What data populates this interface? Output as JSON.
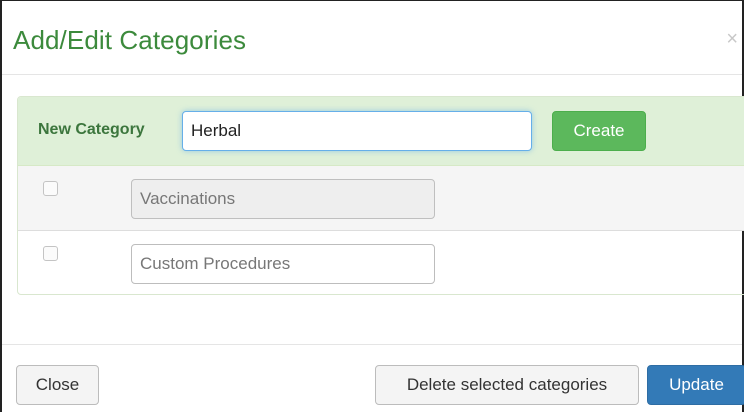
{
  "modal": {
    "title": "Add/Edit Categories",
    "close_glyph": "×"
  },
  "new_category": {
    "label": "New Category",
    "value": "Herbal",
    "create_label": "Create"
  },
  "categories": [
    {
      "name": "Vaccinations",
      "readonly": true,
      "checked": false
    },
    {
      "name": "Custom Procedures",
      "readonly": false,
      "checked": false
    }
  ],
  "footer": {
    "close_label": "Close",
    "delete_label": "Delete selected categories",
    "update_label": "Update"
  },
  "colors": {
    "title": "#3c8a3c",
    "panel_heading_bg": "#dff0d8",
    "create_button": "#5cb85c",
    "update_button": "#337ab7"
  }
}
